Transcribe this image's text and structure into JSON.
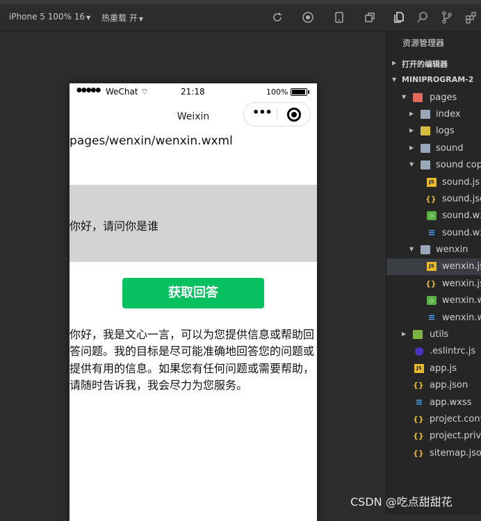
{
  "toolbar": {
    "device_label": "iPhone 5 100% 16",
    "reload_label": "热重载 开"
  },
  "phone": {
    "status": {
      "carrier": "WeChat",
      "time": "21:18",
      "battery": "100%"
    },
    "nav_title": "Weixin",
    "path_text": "pages/wenxin/wenxin.wxml",
    "question": "你好，请问你是谁",
    "button_label": "获取回答",
    "answer": "你好，我是文心一言，可以为您提供信息或帮助回答问题。我的目标是尽可能准确地回答您的问题或提供有用的信息。如果您有任何问题或需要帮助，请随时告诉我，我会尽力为您服务。"
  },
  "explorer": {
    "title": "资源管理器",
    "open_editors": "打开的编辑器",
    "project": "MINIPROGRAM-2",
    "tree": [
      {
        "label": "pages",
        "icon": "folder-pages-icon"
      },
      {
        "label": "index",
        "icon": "folder-icon"
      },
      {
        "label": "logs",
        "icon": "folder-logs-icon"
      },
      {
        "label": "sound",
        "icon": "folder-icon"
      },
      {
        "label": "sound cop",
        "icon": "folder-open-icon"
      },
      {
        "label": "sound.js",
        "icon": "js-file-icon"
      },
      {
        "label": "sound.jso",
        "icon": "json-file-icon"
      },
      {
        "label": "sound.wx",
        "icon": "wxml-file-icon"
      },
      {
        "label": "sound.wx",
        "icon": "wxss-file-icon"
      },
      {
        "label": "wenxin",
        "icon": "folder-open-icon"
      },
      {
        "label": "wenxin.js",
        "icon": "js-file-icon"
      },
      {
        "label": "wenxin.js",
        "icon": "json-file-icon"
      },
      {
        "label": "wenxin.w",
        "icon": "wxml-file-icon"
      },
      {
        "label": "wenxin.w",
        "icon": "wxss-file-icon"
      },
      {
        "label": "utils",
        "icon": "folder-utils-icon"
      },
      {
        "label": ".eslintrc.js",
        "icon": "eslint-file-icon"
      },
      {
        "label": "app.js",
        "icon": "js-file-icon"
      },
      {
        "label": "app.json",
        "icon": "json-file-icon"
      },
      {
        "label": "app.wxss",
        "icon": "wxss-file-icon"
      },
      {
        "label": "project.conf",
        "icon": "json-file-icon"
      },
      {
        "label": "project.priva",
        "icon": "json-file-icon"
      },
      {
        "label": "sitemap.json",
        "icon": "json-file-icon"
      }
    ]
  },
  "watermark": "CSDN @吃点甜甜花"
}
